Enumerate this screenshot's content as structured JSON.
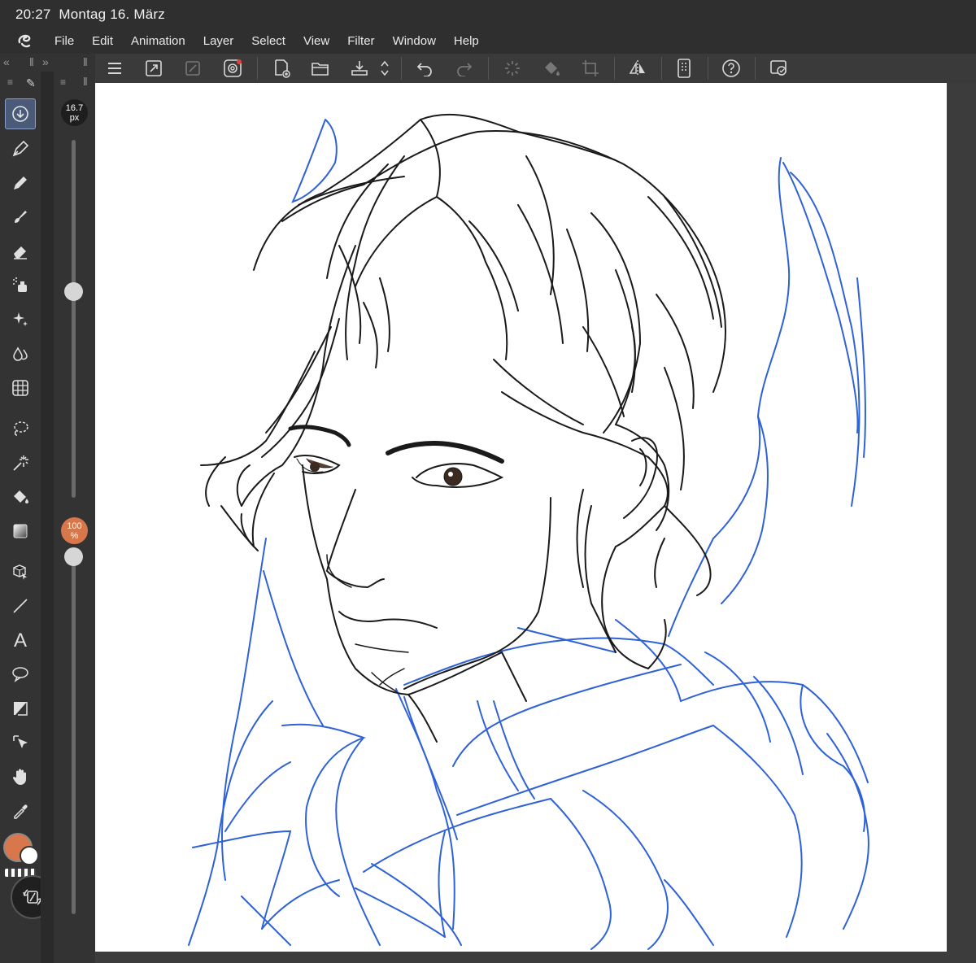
{
  "status": {
    "time": "20:27",
    "date": "Montag 16. März"
  },
  "menubar": {
    "logo_icon": "clip-studio-logo-icon",
    "items": [
      "File",
      "Edit",
      "Animation",
      "Layer",
      "Select",
      "View",
      "Filter",
      "Window",
      "Help"
    ]
  },
  "toolbar": {
    "icons": [
      "hamburger-menu-icon",
      "resize-icon",
      "transform-icon",
      "spiral-icon",
      "new-canvas-icon",
      "open-folder-icon",
      "export-icon",
      "arrows-updown-icon",
      "undo-icon",
      "redo-icon",
      "spinner-icon",
      "fill-icon",
      "crop-icon",
      "flip-horizontal-icon",
      "device-icon",
      "help-icon",
      "companion-icon"
    ]
  },
  "toolbox": {
    "tools": [
      "download-tool",
      "pen-tool",
      "pencil-tool",
      "brush-tool",
      "eraser-tool",
      "airbrush-tool",
      "decoration-tool",
      "blend-tool",
      "grid-tool",
      "lasso-tool",
      "auto-select-tool",
      "fill-tool",
      "gradient-tool",
      "3d-operation-tool",
      "line-tool",
      "text-tool",
      "speech-balloon-tool",
      "frame-tool",
      "object-tool",
      "hand-tool",
      "eyedropper-tool"
    ]
  },
  "brush": {
    "size_value": "16.7",
    "size_unit": "px",
    "size_slider_fraction": 0.42,
    "opacity_value": "100",
    "opacity_unit": "%",
    "opacity_slider_fraction": 0.0
  },
  "colors": {
    "main": "#d9774c",
    "sub": "#ffffff",
    "accent": "#4a5a78",
    "sketch_black": "#1a1a1a",
    "sketch_blue": "#2f62d6"
  }
}
